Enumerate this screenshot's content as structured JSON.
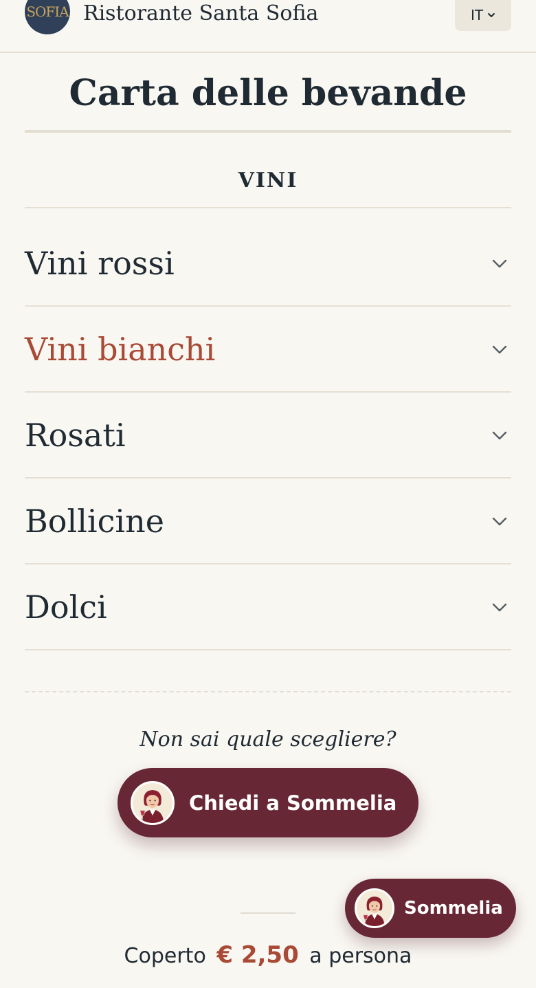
{
  "header": {
    "logo_text": "SOFIA",
    "restaurant_name": "Ristorante Santa Sofia",
    "language": "IT",
    "chevron_icon": "chevron-down-icon"
  },
  "page": {
    "title": "Carta delle bevande",
    "section": "VINI"
  },
  "categories": [
    {
      "label": "Vini rossi",
      "active": false
    },
    {
      "label": "Vini bianchi",
      "active": true
    },
    {
      "label": "Rosati",
      "active": false
    },
    {
      "label": "Bollicine",
      "active": false
    },
    {
      "label": "Dolci",
      "active": false
    }
  ],
  "sommelier": {
    "prompt": "Non sai quale scegliere?",
    "ask_label": "Chiedi a Sommelia",
    "fab_label": "Sommelia",
    "avatar_icon": "sommelier-avatar-icon"
  },
  "footer": {
    "cover_prefix": "Coperto",
    "cover_price": "€ 2,50",
    "cover_suffix": "a persona"
  },
  "colors": {
    "background": "#f9f7f2",
    "text": "#1f2a33",
    "accent": "#a84a36",
    "button": "#672734",
    "logo_bg": "#2f4058"
  }
}
